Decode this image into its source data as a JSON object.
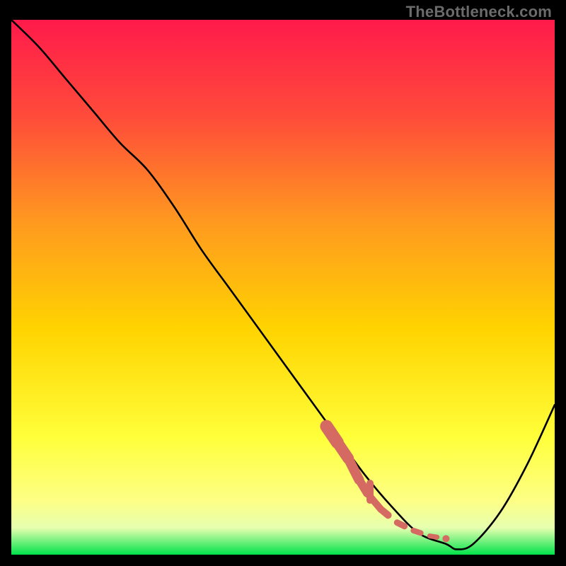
{
  "watermark": "TheBottleneck.com",
  "chart_data": {
    "type": "line",
    "title": "",
    "xlabel": "",
    "ylabel": "",
    "xlim": [
      0,
      100
    ],
    "ylim": [
      0,
      100
    ],
    "grid": false,
    "legend": false,
    "background_gradient": {
      "top_color": "#ff1a4b",
      "mid_colors": [
        "#ff7a1f",
        "#ffd400",
        "#ffff44"
      ],
      "bottom_color": "#00e24a"
    },
    "series": [
      {
        "name": "bottleneck-curve",
        "color": "#000000",
        "x": [
          0,
          5,
          10,
          15,
          20,
          25,
          30,
          35,
          40,
          45,
          50,
          55,
          60,
          65,
          70,
          75,
          80,
          82,
          85,
          90,
          95,
          100
        ],
        "y": [
          100,
          95,
          89,
          83,
          77,
          72,
          65,
          57,
          50,
          43,
          36,
          29,
          22,
          15,
          9,
          4,
          2,
          1,
          2,
          8,
          17,
          28
        ]
      }
    ],
    "highlight": {
      "name": "marked-region",
      "color": "#d46a62",
      "style": "thick-dashes",
      "x": [
        58,
        60,
        62,
        64,
        65.5,
        68,
        71,
        74,
        77,
        80
      ],
      "y": [
        24,
        21,
        18,
        14,
        11.5,
        8.5,
        6,
        4.5,
        3.5,
        3
      ]
    }
  }
}
